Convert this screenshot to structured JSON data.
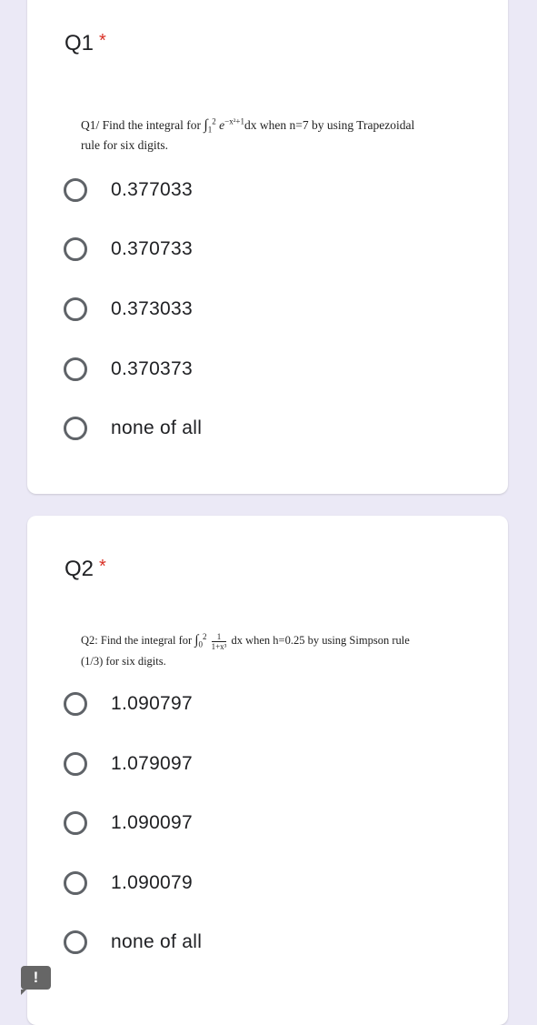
{
  "questions": [
    {
      "title": "Q1",
      "required_mark": "*",
      "text": {
        "prefix": "Q1/ Find the integral for ",
        "integral_sign": "∫",
        "lower": "1",
        "upper": "2",
        "integrand_base": "e",
        "integrand_exp": "−x²+1",
        "suffix": "dx when n=7 by using Trapezoidal",
        "line2": "rule for six digits."
      },
      "options": [
        "0.377033",
        "0.370733",
        "0.373033",
        "0.370373",
        "none of all"
      ]
    },
    {
      "title": "Q2",
      "required_mark": "*",
      "text": {
        "prefix": "Q2: Find the integral for ",
        "integral_sign": "∫",
        "lower": "0",
        "upper": "2",
        "frac_num": "1",
        "frac_den": "1+x³",
        "suffix": " dx when h=0.25 by using Simpson rule",
        "line2": "(1/3) for six digits."
      },
      "options": [
        "1.090797",
        "1.079097",
        "1.090097",
        "1.090079",
        "none of all"
      ]
    }
  ],
  "feedback_button": {
    "label": "!",
    "icon": "report-problem-icon"
  }
}
